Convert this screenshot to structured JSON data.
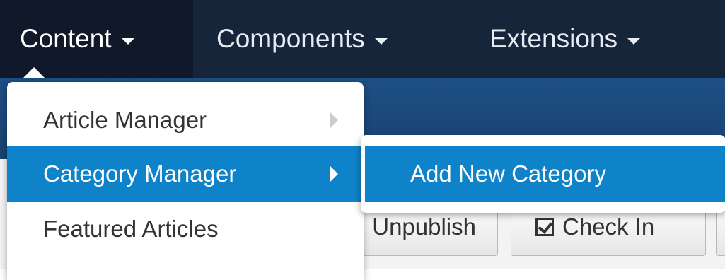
{
  "navbar": {
    "items": [
      {
        "label": "Content",
        "active": true
      },
      {
        "label": "Components",
        "active": false
      },
      {
        "label": "Extensions",
        "active": false
      }
    ]
  },
  "content_menu": {
    "items": [
      {
        "label": "Article Manager",
        "has_submenu": true,
        "highlighted": false
      },
      {
        "label": "Category Manager",
        "has_submenu": true,
        "highlighted": true
      },
      {
        "label": "Featured Articles",
        "has_submenu": false,
        "highlighted": false
      }
    ],
    "submenu": {
      "items": [
        {
          "label": "Add New Category",
          "highlighted": true
        }
      ]
    }
  },
  "toolbar": {
    "unpublish_label": "Unpublish",
    "checkin_label": "Check In"
  },
  "colors": {
    "navbar": "#17253b",
    "navbar_active": "#10192a",
    "subheader": "#1d4f86",
    "menu_highlight": "#0e83c9"
  },
  "icons": {
    "nav_caret": "chevron-down-icon",
    "submenu_arrow": "chevron-right-icon",
    "checkin": "checkbox-checked-icon"
  }
}
